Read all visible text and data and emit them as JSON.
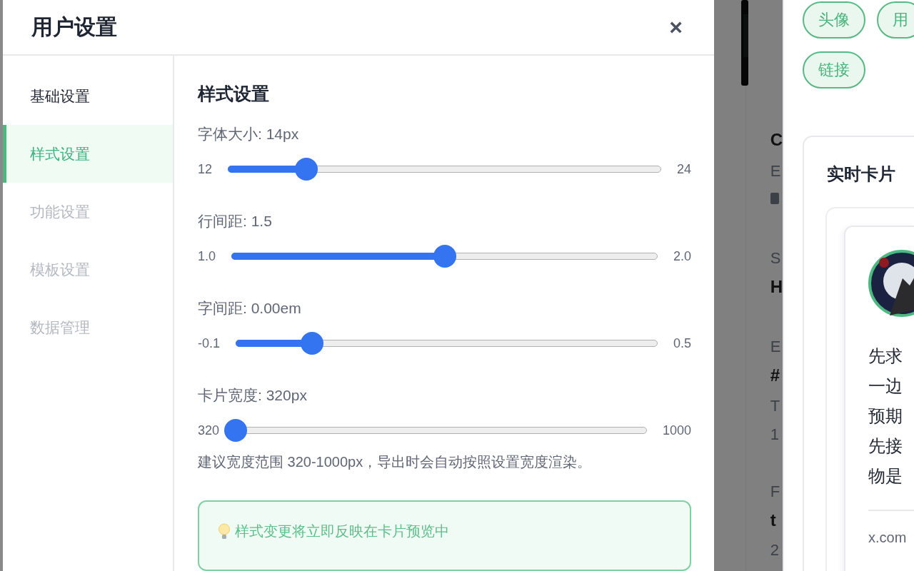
{
  "dialog": {
    "title": "用户设置",
    "close": "×"
  },
  "sidebar": {
    "items": [
      {
        "label": "基础设置",
        "selected": false,
        "disabled": false
      },
      {
        "label": "样式设置",
        "selected": true,
        "disabled": false
      },
      {
        "label": "功能设置",
        "selected": false,
        "disabled": true
      },
      {
        "label": "模板设置",
        "selected": false,
        "disabled": true
      },
      {
        "label": "数据管理",
        "selected": false,
        "disabled": true
      }
    ]
  },
  "section": {
    "title": "样式设置",
    "sliders": [
      {
        "label": "字体大小: 14px",
        "min": "12",
        "max": "24",
        "level": 0.18
      },
      {
        "label": "行间距: 1.5",
        "min": "1.0",
        "max": "2.0",
        "level": 0.5
      },
      {
        "label": "字间距: 0.00em",
        "min": "-0.1",
        "max": "0.5",
        "level": 0.18
      },
      {
        "label": "卡片宽度: 320px",
        "min": "320",
        "max": "1000",
        "level": 0
      }
    ],
    "hint": "建议宽度范围 320-1000px，导出时会自动按照设置宽度渲染。",
    "tip": "样式变更将立即反映在卡片预览中"
  },
  "background": {
    "fragments": [
      {
        "text": "C",
        "kind": "heading"
      },
      {
        "text": "E",
        "kind": "label"
      },
      {
        "text": "S",
        "kind": "label"
      },
      {
        "text": "H",
        "kind": "heading"
      },
      {
        "text": "E",
        "kind": "label"
      },
      {
        "text": "#",
        "kind": "heading"
      },
      {
        "text": "T",
        "kind": "label"
      },
      {
        "text": "1",
        "kind": "label"
      },
      {
        "text": "F",
        "kind": "label"
      },
      {
        "text": "t",
        "kind": "heading"
      },
      {
        "text": "2",
        "kind": "label"
      }
    ]
  },
  "preview_panel": {
    "tags": [
      {
        "label": "头像"
      },
      {
        "label": "用"
      },
      {
        "label": "链接"
      }
    ],
    "title": "实时卡片",
    "card": {
      "lines": [
        "先求",
        "一边",
        "预期",
        "先接",
        "物是"
      ],
      "source": "x.com"
    }
  }
}
